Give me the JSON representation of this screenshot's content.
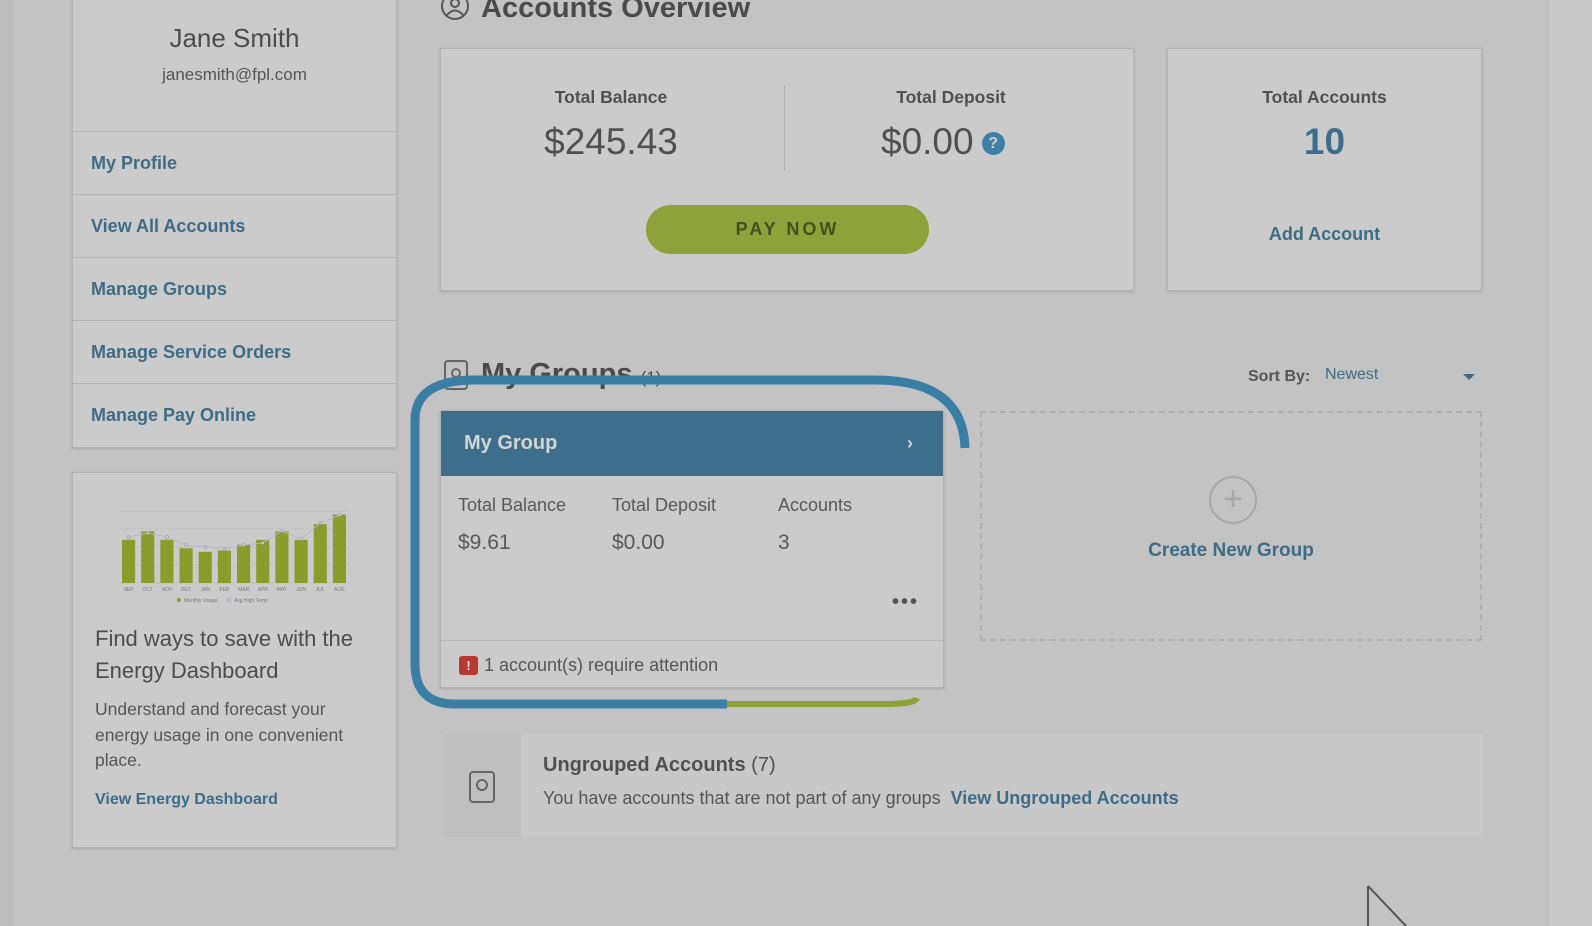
{
  "profile": {
    "name": "Jane Smith",
    "email": "janesmith@fpl.com"
  },
  "nav": [
    {
      "label": "My Profile"
    },
    {
      "label": "View All Accounts"
    },
    {
      "label": "Manage Groups"
    },
    {
      "label": "Manage Service Orders"
    },
    {
      "label": "Manage Pay Online"
    }
  ],
  "energy": {
    "title": "Find ways to save with the Energy Dashboard",
    "description": "Understand and forecast your energy usage in one convenient place.",
    "link": "View Energy Dashboard",
    "chart": {
      "months": [
        "SEP",
        "OCT",
        "NOV",
        "DEC",
        "JAN",
        "FEB",
        "MAR",
        "APR",
        "MAY",
        "JUN",
        "JUL",
        "AUG"
      ],
      "usage": [
        72,
        86,
        72,
        58,
        52,
        54,
        64,
        72,
        86,
        72,
        98,
        114
      ],
      "temp": [
        83,
        85,
        83,
        79,
        78,
        77,
        79,
        80,
        86,
        82,
        90,
        94
      ],
      "legend": [
        "Monthly Usage",
        "Avg High Temp"
      ],
      "bar_color": "#8a9c2c"
    }
  },
  "overview": {
    "title": "Accounts Overview",
    "total_balance_label": "Total Balance",
    "total_balance": "$245.43",
    "total_deposit_label": "Total Deposit",
    "total_deposit": "$0.00",
    "help": "?",
    "pay_now": "PAY NOW",
    "total_accounts_label": "Total Accounts",
    "total_accounts": "10",
    "add_account": "Add Account"
  },
  "groups": {
    "title": "My Groups",
    "count": "(1)",
    "sort_label": "Sort By:",
    "sort_value": "Newest",
    "items": [
      {
        "name": "My Group",
        "balance_label": "Total Balance",
        "balance": "$9.61",
        "deposit_label": "Total Deposit",
        "deposit": "$0.00",
        "accounts_label": "Accounts",
        "accounts": "3",
        "more": "•••",
        "alert_icon": "!",
        "alert": "1 account(s) require attention"
      }
    ],
    "create": "Create New Group"
  },
  "ungrouped": {
    "title": "Ungrouped Accounts",
    "count": "(7)",
    "description": "You have accounts that are not part of any groups",
    "link": "View Ungrouped Accounts"
  },
  "colors": {
    "accent": "#3d6f8c",
    "link": "#3e6b85",
    "pay": "#8ea23a",
    "highlight_ring": "#3a7ea6",
    "alert": "#b73a32"
  }
}
